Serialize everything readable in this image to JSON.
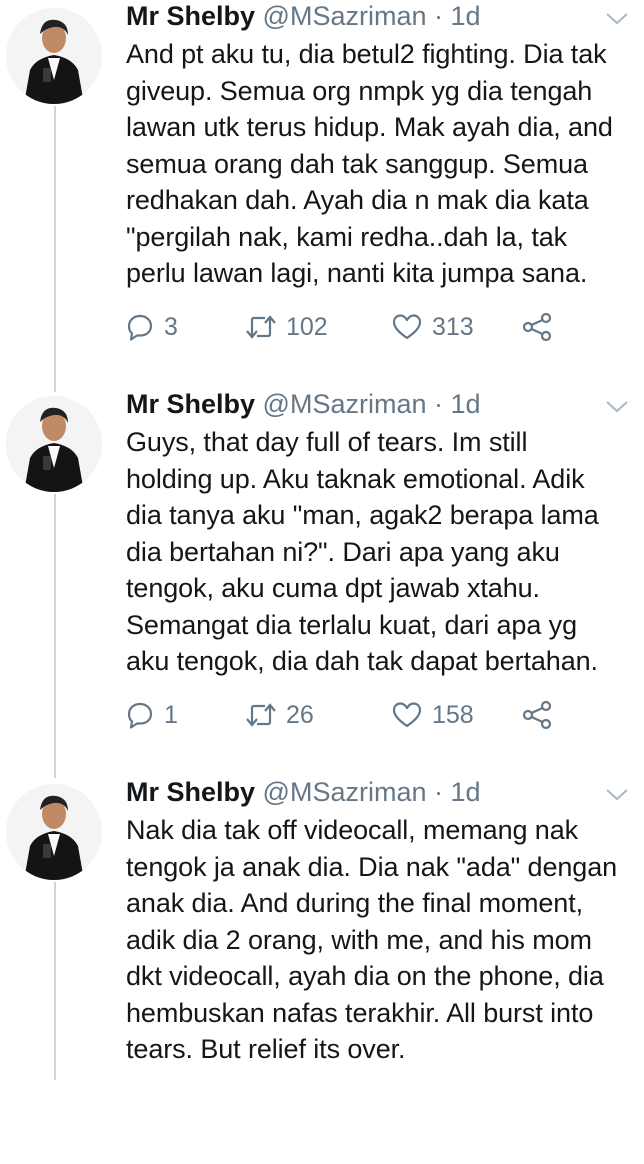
{
  "colors": {
    "text": "#14171a",
    "secondary": "#657786",
    "thread_line": "#ccd6dd"
  },
  "tweets": [
    {
      "name": "Mr Shelby",
      "handle": "@MSazriman",
      "separator": "·",
      "time": "1d",
      "text": "And pt aku tu, dia betul2 fighting. Dia tak\ngiveup. Semua org nmpk yg dia tengah\nlawan utk terus hidup. Mak ayah dia, and\nsemua orang dah tak sanggup. Semua\nredhakan dah. Ayah dia n mak dia kata\n\"pergilah nak, kami redha..dah la, tak\nperlu lawan lagi, nanti kita jumpa sana.",
      "replies": "3",
      "retweets": "102",
      "likes": "313"
    },
    {
      "name": "Mr Shelby",
      "handle": "@MSazriman",
      "separator": "·",
      "time": "1d",
      "text": "Guys, that day full of tears. Im still\nholding up. Aku taknak emotional. Adik\ndia tanya aku \"man, agak2 berapa lama\ndia bertahan ni?\". Dari apa yang aku\ntengok, aku cuma dpt jawab  xtahu.\nSemangat dia terlalu kuat, dari apa yg\naku tengok, dia dah tak dapat bertahan.",
      "replies": "1",
      "retweets": "26",
      "likes": "158"
    },
    {
      "name": "Mr Shelby",
      "handle": "@MSazriman",
      "separator": "·",
      "time": "1d",
      "text": "Nak dia tak off videocall, memang nak\ntengok ja anak dia. Dia nak \"ada\" dengan\nanak dia. And during the final moment,\nadik dia 2 orang, with me, and his mom\ndkt videocall, ayah dia on the phone, dia\nhembuskan nafas terakhir. All burst into\ntears. But relief its over."
    }
  ]
}
